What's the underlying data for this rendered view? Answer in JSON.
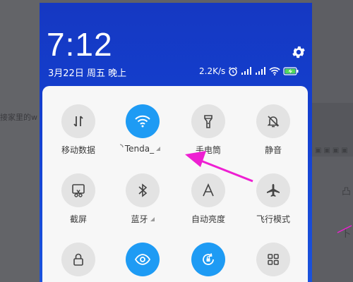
{
  "background": {
    "left_text": "接家里的w",
    "right_chars": [
      "凸",
      "卜"
    ]
  },
  "statusbar": {
    "time": "7:12",
    "date": "3月22日 周五 晚上",
    "network_speed": "2.2K/s",
    "icons": [
      "alarm-icon",
      "signal-icon",
      "signal-icon-2",
      "wifi-icon",
      "battery-charging-icon"
    ],
    "settings_icon": "gear-icon"
  },
  "tiles": [
    {
      "label": "移动数据",
      "icon": "mobile-data-icon",
      "active": false
    },
    {
      "label": "Tenda_",
      "icon": "wifi-icon",
      "active": true
    },
    {
      "label": "手电筒",
      "icon": "flashlight-icon",
      "active": false
    },
    {
      "label": "静音",
      "icon": "mute-bell-icon",
      "active": false
    },
    {
      "label": "截屏",
      "icon": "screenshot-icon",
      "active": false
    },
    {
      "label": "蓝牙",
      "icon": "bluetooth-icon",
      "active": false
    },
    {
      "label": "自动亮度",
      "icon": "auto-brightness-icon",
      "active": false
    },
    {
      "label": "飞行模式",
      "icon": "airplane-icon",
      "active": false
    },
    {
      "label": "",
      "icon": "lock-icon",
      "active": false
    },
    {
      "label": "",
      "icon": "eye-icon",
      "active": true
    },
    {
      "label": "",
      "icon": "auto-rotate-icon",
      "active": true
    },
    {
      "label": "",
      "icon": "grid-icon",
      "active": false
    }
  ],
  "colors": {
    "active_tile": "#1e9bf4",
    "annotation_arrow": "#ee1fd2",
    "screen_blue": "#1440d0"
  }
}
